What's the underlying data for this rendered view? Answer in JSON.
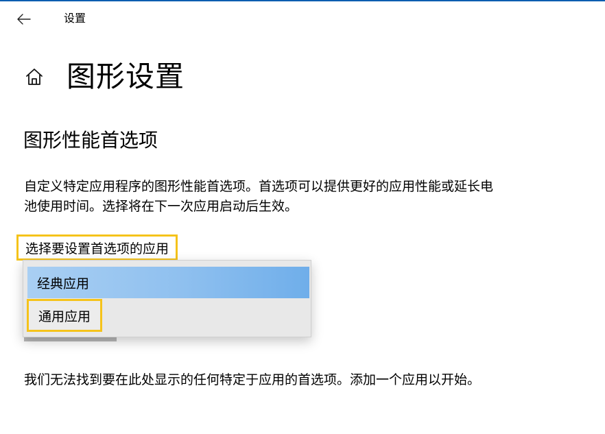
{
  "header": {
    "back_icon": "back-arrow-icon",
    "window_title": "设置"
  },
  "page": {
    "home_icon": "home-icon",
    "title": "图形设置"
  },
  "section": {
    "title": "图形性能首选项",
    "description": "自定义特定应用程序的图形性能首选项。首选项可以提供更好的应用性能或延长电池使用时间。选择将在下一次应用启动后生效。"
  },
  "app_picker": {
    "label": "选择要设置首选项的应用",
    "options": [
      {
        "label": "经典应用",
        "state": "hovered"
      },
      {
        "label": "通用应用",
        "state": "highlighted"
      }
    ]
  },
  "footer": {
    "message": "我们无法找到要在此处显示的任何特定于应用的首选项。添加一个应用以开始。"
  },
  "colors": {
    "accent_topline": "#0a5db0",
    "highlight_outline": "#f5c31a",
    "selected_option": "#8fc0ef",
    "dropdown_bg": "#e8e8e8"
  }
}
